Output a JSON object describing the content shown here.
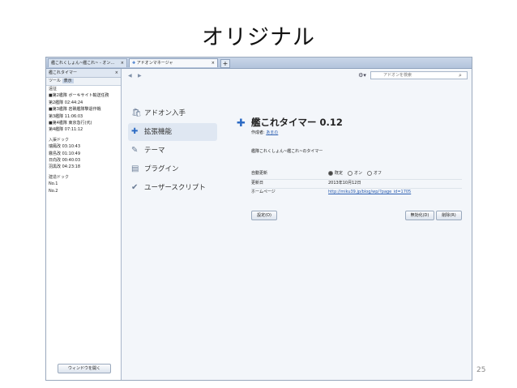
{
  "slide": {
    "title": "オリジナル",
    "page_number": "25"
  },
  "browser": {
    "tabs": [
      {
        "label": "艦これくしょん~艦これ~ - オン…",
        "close": "×"
      },
      {
        "label": "アドオンマネージャ",
        "close": "×"
      }
    ],
    "new_tab": "+"
  },
  "sidebar": {
    "title": "艦これタイマー",
    "close": "×",
    "tab_tool": "ツール",
    "tab_view": "表示",
    "lines": [
      {
        "text": "遠征",
        "head": true
      },
      {
        "text": "■第2艦隊 ボーキサイト輸送任務"
      },
      {
        "text": "第2艦隊 02:44:24"
      },
      {
        "text": "■第3艦隊 岩礁艦隊撃退作戦"
      },
      {
        "text": "第3艦隊 11:06:03"
      },
      {
        "text": "■第4艦隊 東京急行(弐)"
      },
      {
        "text": "第4艦隊 07:11:12"
      },
      {
        "gap": true
      },
      {
        "text": "入渠ドック",
        "head": true
      },
      {
        "text": "瑞鳳改 03:10:43"
      },
      {
        "text": "霧島改 01:10:49"
      },
      {
        "text": "日向改 00:40:03"
      },
      {
        "text": "羽黒改 04:23:18"
      },
      {
        "gap": true
      },
      {
        "text": "建造ドック",
        "head": true
      },
      {
        "text": "No.1"
      },
      {
        "text": "No.2"
      }
    ],
    "open_window_button": "ウィンドウを開く"
  },
  "addons": {
    "search_placeholder": "アドオンを検索",
    "categories": [
      {
        "label": "アドオン入手",
        "icon": "get-addons-icon",
        "selected": false
      },
      {
        "label": "拡張機能",
        "icon": "extensions-icon",
        "selected": true
      },
      {
        "label": "テーマ",
        "icon": "themes-icon",
        "selected": false
      },
      {
        "label": "プラグイン",
        "icon": "plugins-icon",
        "selected": false
      },
      {
        "label": "ユーザースクリプト",
        "icon": "userscripts-icon",
        "selected": false
      }
    ],
    "detail": {
      "name": "艦これタイマー 0.12",
      "author_label": "作成者:",
      "author": "あまの",
      "description": "艦隊これくしょん~艦これ~のタイマー",
      "auto_update_label": "自動更新",
      "auto_update_options": [
        "既定",
        "オン",
        "オフ"
      ],
      "auto_update_selected": 0,
      "updated_label": "更新日",
      "updated_value": "2013年10月12日",
      "homepage_label": "ホームページ",
      "homepage_value": "http://miku39.jp/blog/wp/?page_id=1705",
      "settings_button": "設定(O)",
      "disable_button": "無効化(D)",
      "remove_button": "削除(R)"
    }
  },
  "colors": {
    "link": "#2a5db0",
    "accent": "#2d6bc4",
    "sidebar_bg": "#ffffff",
    "content_bg": "#f3f6fa"
  }
}
